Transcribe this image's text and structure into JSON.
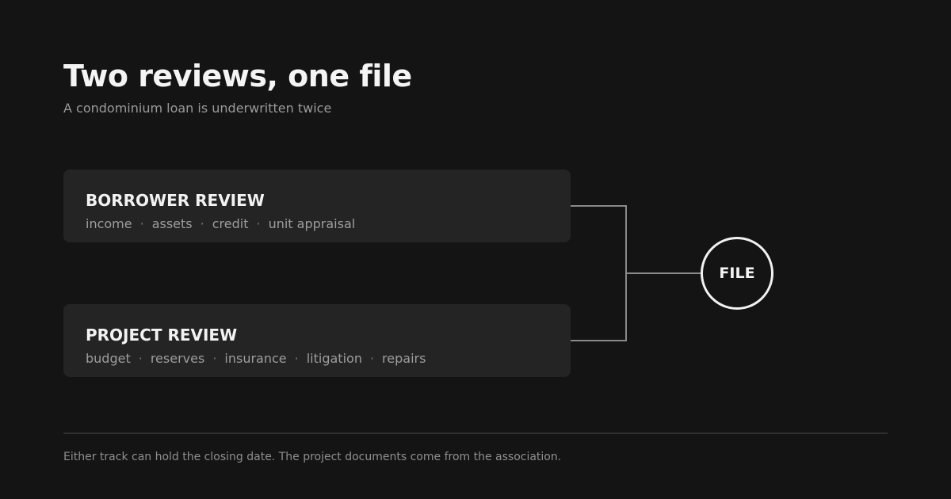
{
  "header": {
    "title": "Two reviews, one file",
    "subtitle": "A condominium loan is underwritten twice"
  },
  "reviews": [
    {
      "title": "BORROWER REVIEW",
      "items": [
        "income",
        "assets",
        "credit",
        "unit appraisal"
      ]
    },
    {
      "title": "PROJECT REVIEW",
      "items": [
        "budget",
        "reserves",
        "insurance",
        "litigation",
        "repairs"
      ]
    }
  ],
  "merge_node": {
    "label": "FILE"
  },
  "footer": {
    "note": "Either track can hold the closing date. The project documents come from the association."
  },
  "colors": {
    "background": "#141414",
    "card": "#242424",
    "connector": "#8a8a8a",
    "node_border": "#f2f2f2"
  }
}
